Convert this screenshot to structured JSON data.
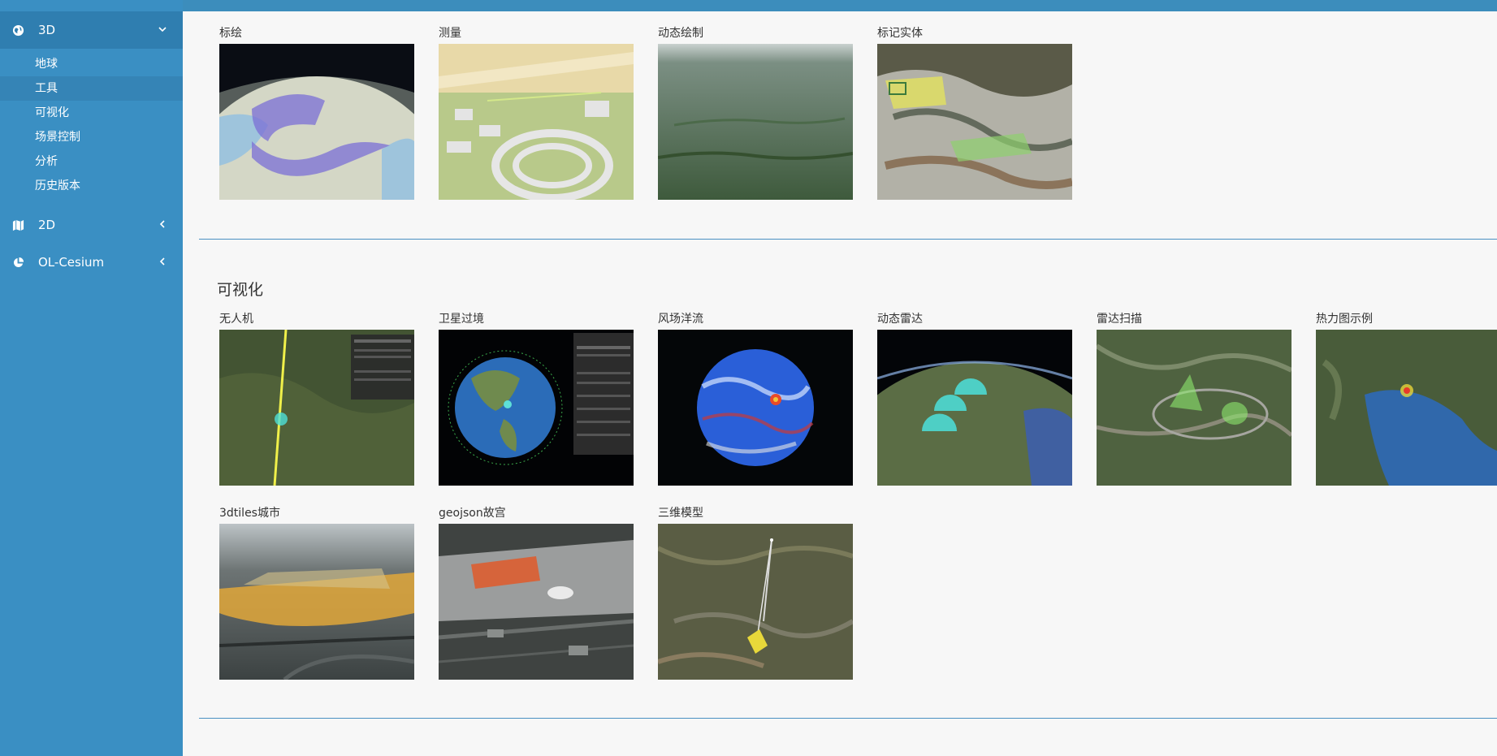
{
  "sidebar": {
    "menus": [
      {
        "label": "3D",
        "icon": "globe-icon",
        "expanded": true
      },
      {
        "label": "2D",
        "icon": "map-icon",
        "expanded": false
      },
      {
        "label": "OL-Cesium",
        "icon": "pie-chart-icon",
        "expanded": false
      }
    ],
    "submenu_3d": [
      "地球",
      "工具",
      "可视化",
      "场景控制",
      "分析",
      "历史版本"
    ],
    "selected_sub": "工具"
  },
  "tools_section": {
    "cards": [
      "标绘",
      "测量",
      "动态绘制",
      "标记实体"
    ]
  },
  "visual_section": {
    "title": "可视化",
    "row1": [
      "无人机",
      "卫星过境",
      "风场洋流",
      "动态雷达",
      "雷达扫描",
      "热力图示例"
    ],
    "row2": [
      "3dtiles城市",
      "geojson故宫",
      "三维模型"
    ]
  },
  "colors": {
    "sidebar": "#3a8fc3",
    "sidebar_active": "#2f7eb0",
    "topbar": "#3c8dbc",
    "divider": "#4a90c2"
  }
}
